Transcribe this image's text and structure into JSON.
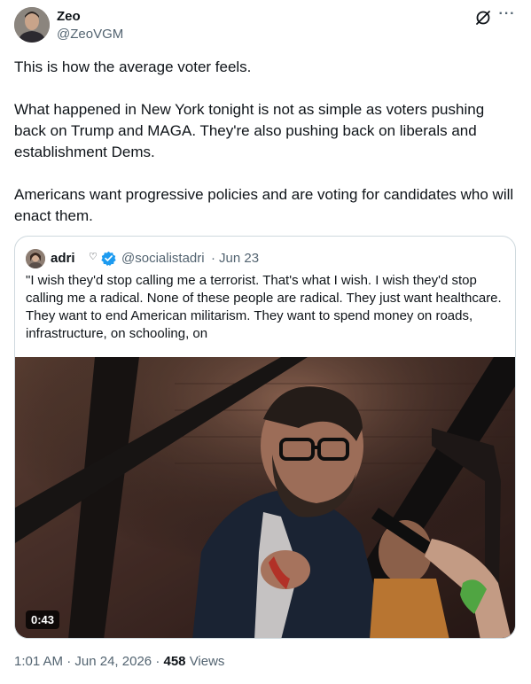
{
  "author": {
    "display_name": "Zeo",
    "handle": "@ZeoVGM",
    "avatar_icon": "profile-photo-avatar"
  },
  "toolbar": {
    "grok_icon": "grok-slash-icon",
    "more_icon": "more-dots-icon"
  },
  "tweet": {
    "paragraphs": [
      "This is how the average voter feels.",
      "What happened in New York tonight is not as simple as voters pushing back on Trump and MAGA. They're also pushing back on liberals and establishment Dems.",
      "Americans want progressive policies and are voting for candidates who will enact them."
    ]
  },
  "quoted": {
    "display_name": "adri",
    "name_emoji": "♡",
    "verified": true,
    "handle": "@socialistadri",
    "separator": "·",
    "date": "Jun 23",
    "text": "\"I wish they'd stop calling me a terrorist. That's what I wish. I wish they'd stop calling me a radical. None of these people are radical. They just want healthcare. They want to end American militarism. They want to spend money on roads, infrastructure, on schooling, on",
    "video": {
      "duration": "0:43"
    }
  },
  "meta": {
    "time": "1:01 AM",
    "sep1": "·",
    "date": "Jun 24, 2026",
    "sep2": "·",
    "views_count": "458",
    "views_label": "Views"
  },
  "colors": {
    "text_primary": "#0f1419",
    "text_secondary": "#536471",
    "border": "#cfd9de",
    "verified_blue": "#1d9bf0"
  }
}
